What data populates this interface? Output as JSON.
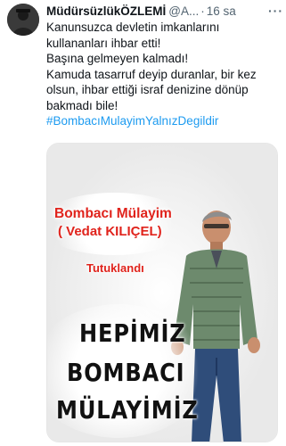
{
  "tweet": {
    "author_name": "MüdürsüzlükÖZLEMİ",
    "handle": "@A...",
    "separator": "·",
    "time": "16 sa",
    "more": "···",
    "lines": [
      "Kanunsuzca devletin imkanlarını kullananları ihbar etti!",
      "Başına gelmeyen kalmadı!",
      "Kamuda tasarruf deyip duranlar, bir kez olsun, ihbar ettiği israf denizine dönüp bakmadı bile!"
    ],
    "hashtag": "#BombacıMulayimYalnızDegildir"
  },
  "media": {
    "title_line1": "Bombacı Mülayim",
    "title_line2": "( Vedat KILIÇEL)",
    "subtitle": "Tutuklandı",
    "slogan_line1": "HEPİMİZ",
    "slogan_line2": "BOMBACI",
    "slogan_line3": "MÜLAYİMİZ"
  },
  "colors": {
    "hashtag": "#1d9bf0",
    "title_red": "#e0231c",
    "muted": "#536471"
  }
}
